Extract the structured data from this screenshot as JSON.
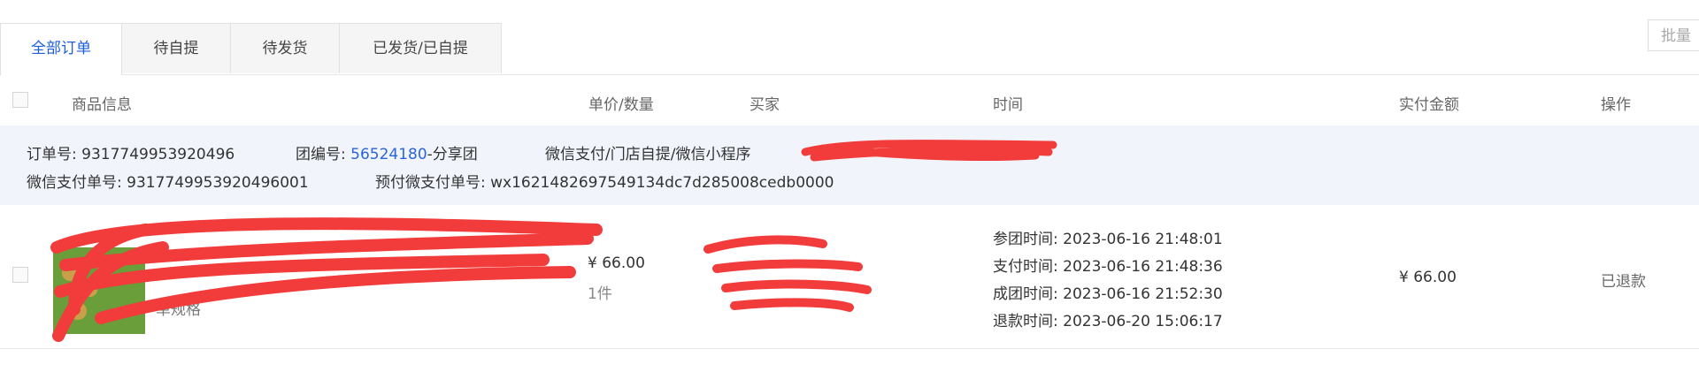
{
  "tabs": [
    {
      "label": "全部订单",
      "active": true
    },
    {
      "label": "待自提",
      "active": false
    },
    {
      "label": "待发货",
      "active": false
    },
    {
      "label": "已发货/已自提",
      "active": false
    }
  ],
  "batch_button": "批量",
  "table_header": {
    "product": "商品信息",
    "price_qty": "单价/数量",
    "buyer": "买家",
    "time": "时间",
    "paid": "实付金额",
    "action": "操作"
  },
  "order_info": {
    "order_no_label": "订单号:",
    "order_no": "9317749953920496",
    "group_no_label": "团编号:",
    "group_no": "56524180",
    "group_type": "-分享团",
    "channel": "微信支付/门店自提/微信小程序",
    "wx_pay_label": "微信支付单号:",
    "wx_pay_no": "9317749953920496001",
    "prepay_label": "预付微支付单号:",
    "prepay_no": "wx1621482697549134dc7d285008cedb0000"
  },
  "order_row": {
    "spec": "单规格",
    "price": "¥ 66.00",
    "qty": "1件",
    "times": [
      {
        "label": "参团时间:",
        "value": "2023-06-16 21:48:01"
      },
      {
        "label": "支付时间:",
        "value": "2023-06-16 21:48:36"
      },
      {
        "label": "成团时间:",
        "value": "2023-06-16 21:52:30"
      },
      {
        "label": "退款时间:",
        "value": "2023-06-20 15:06:17"
      }
    ],
    "paid": "¥ 66.00",
    "status": "已退款"
  },
  "colors": {
    "accent": "#1e5fd8",
    "band": "#f1f5fb",
    "redaction": "#f23b3b"
  }
}
